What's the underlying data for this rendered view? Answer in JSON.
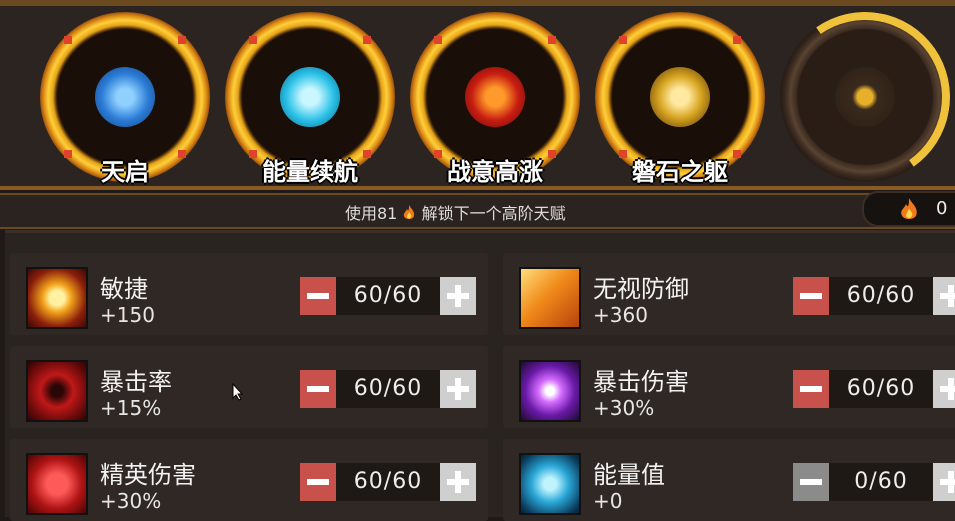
{
  "talents": [
    {
      "label": "天启",
      "icon": "meditating-figure-icon",
      "color": "#2b7cd6"
    },
    {
      "label": "能量续航",
      "icon": "energy-orb-icon",
      "color": "#2cc2e8"
    },
    {
      "label": "战意高涨",
      "icon": "fighting-spirit-icon",
      "color": "#c81d12"
    },
    {
      "label": "磐石之躯",
      "icon": "stone-body-icon",
      "color": "#d7a420"
    },
    {
      "label": "",
      "icon": "locked-talent-icon",
      "color": "#e8b02a"
    }
  ],
  "unlock_bar": {
    "prefix": "使用81",
    "suffix": "解锁下一个高阶天赋",
    "flame_icon": "flame-icon"
  },
  "currency": {
    "value": "0",
    "icon": "flame-icon"
  },
  "stats": [
    {
      "name": "敏捷",
      "value": "+150",
      "count": "60/60",
      "icon": "agility-sun-icon",
      "minus_enabled": true
    },
    {
      "name": "无视防御",
      "value": "+360",
      "count": "60/60",
      "icon": "broken-shield-icon",
      "minus_enabled": true
    },
    {
      "name": "暴击率",
      "value": "+15%",
      "count": "60/60",
      "icon": "crit-rate-swirl-icon",
      "minus_enabled": true
    },
    {
      "name": "暴击伤害",
      "value": "+30%",
      "count": "60/60",
      "icon": "crit-damage-orb-icon",
      "minus_enabled": true
    },
    {
      "name": "精英伤害",
      "value": "+30%",
      "count": "60/60",
      "icon": "demon-skull-icon",
      "minus_enabled": true
    },
    {
      "name": "能量值",
      "value": "+0",
      "count": "0/60",
      "icon": "energy-crystal-icon",
      "minus_enabled": false
    }
  ]
}
